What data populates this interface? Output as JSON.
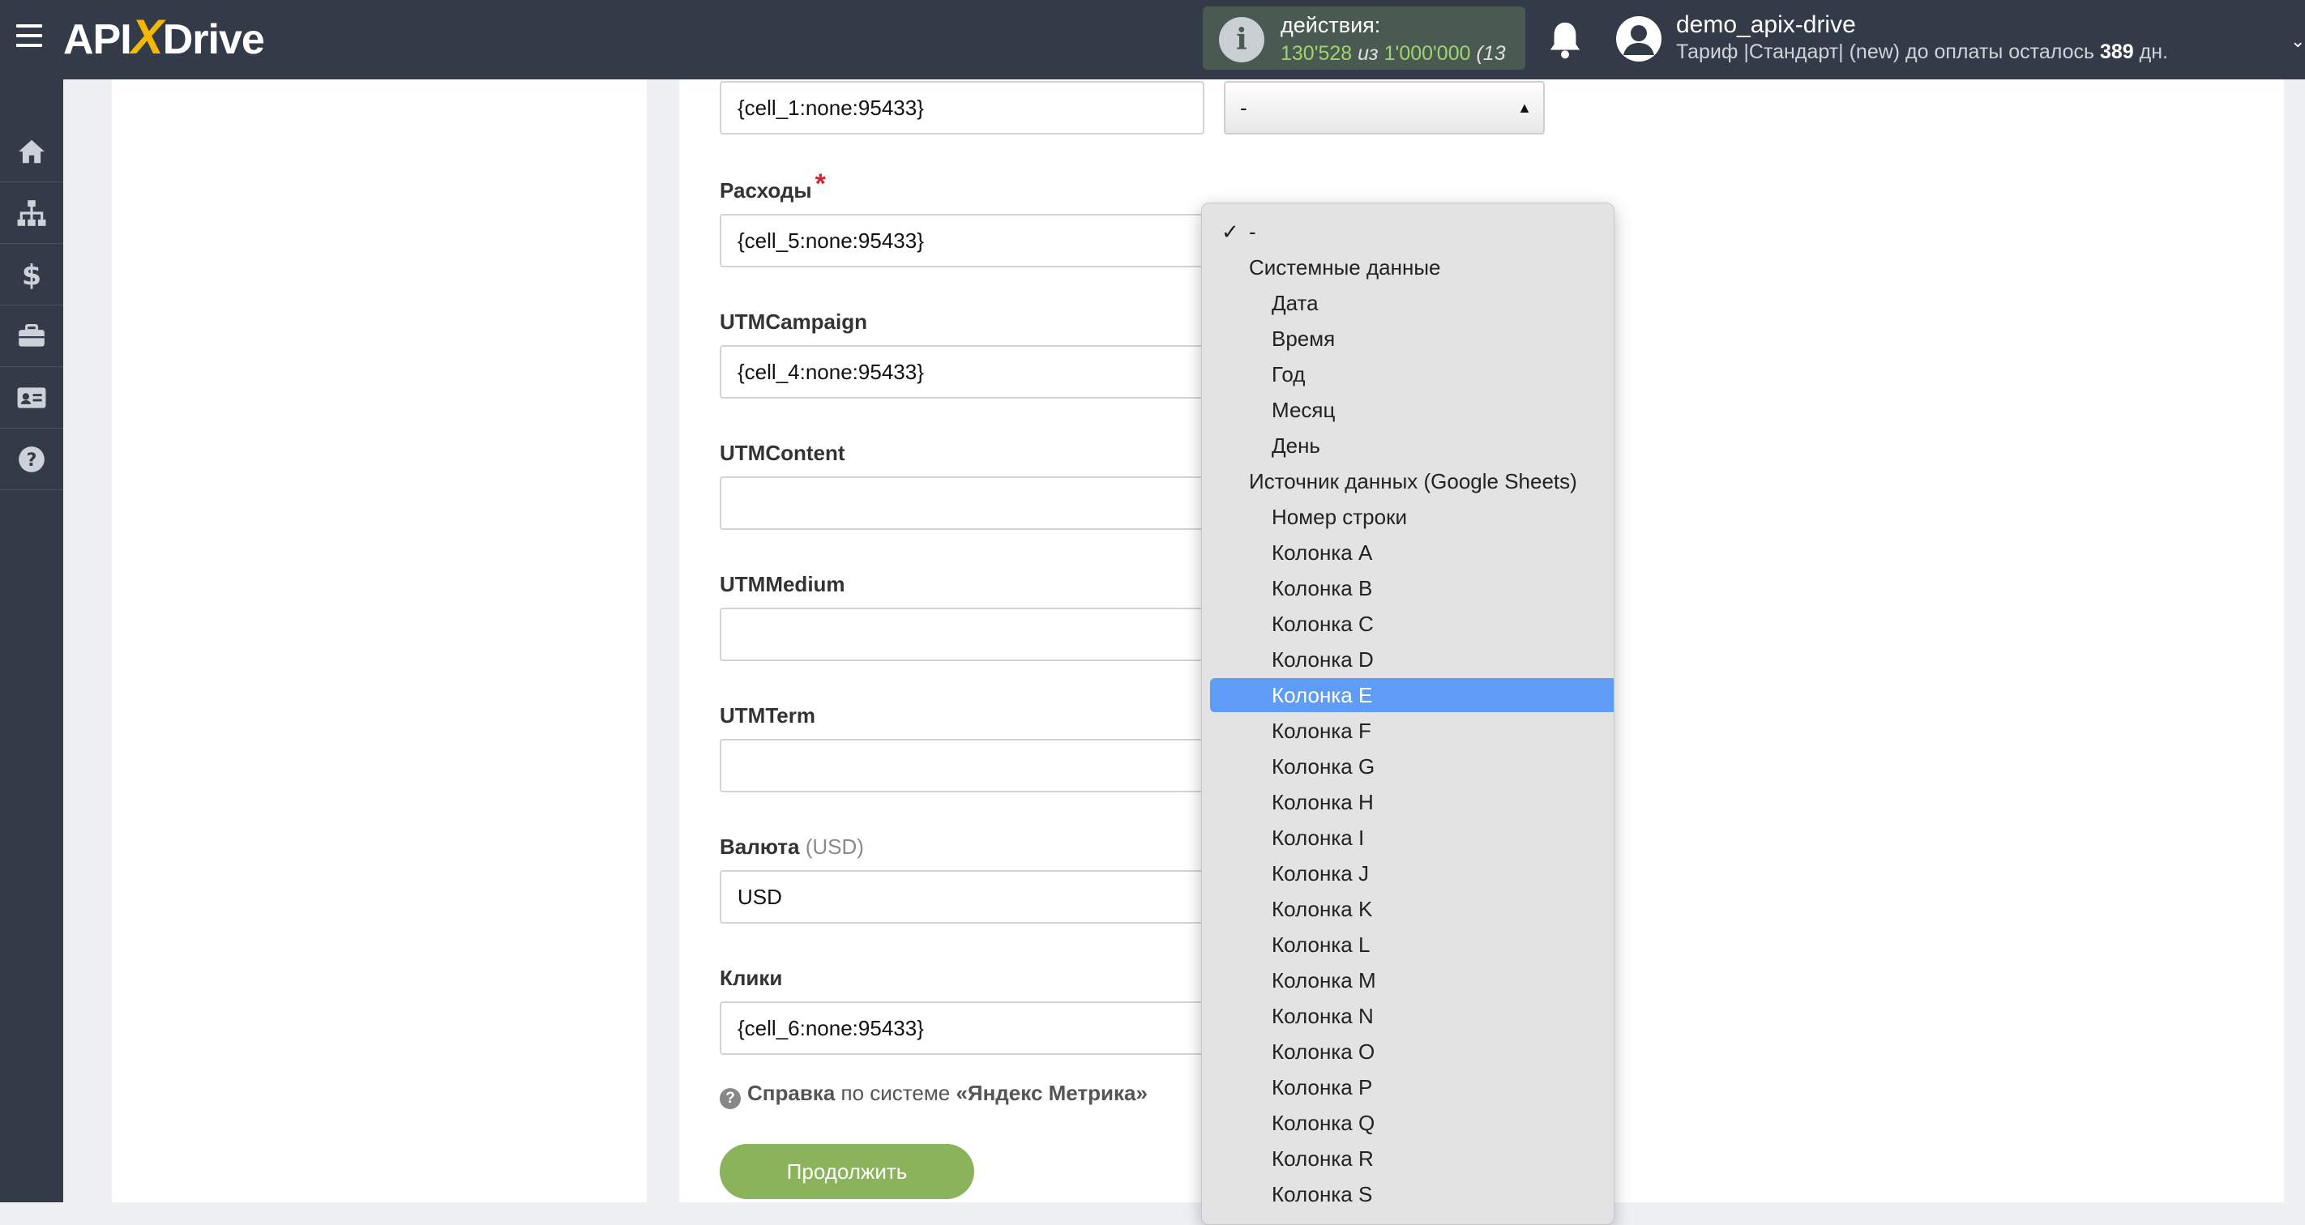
{
  "header": {
    "logo_api": "API",
    "logo_x": "X",
    "logo_drive": "Drive",
    "actions_label": "действия:",
    "actions_used": "130'528",
    "actions_of": "из",
    "actions_total": "1'000'000",
    "actions_extra": "(13",
    "username": "demo_apix-drive",
    "tariff_text": "Тариф |Стандарт| (new) до оплаты осталось",
    "tariff_days": "389",
    "tariff_unit": "дн."
  },
  "sidebar": {
    "items": [
      "home-icon",
      "sitemap-icon",
      "dollar-icon",
      "briefcase-icon",
      "id-card-icon",
      "help-icon"
    ]
  },
  "form": {
    "top_field_value": "{cell_1:none:95433}",
    "top_select_value": "-",
    "fields": [
      {
        "label": "Расходы",
        "required": true,
        "value": "{cell_5:none:95433}"
      },
      {
        "label": "UTMCampaign",
        "value": "{cell_4:none:95433}"
      },
      {
        "label": "UTMContent",
        "value": ""
      },
      {
        "label": "UTMMedium",
        "value": ""
      },
      {
        "label": "UTMTerm",
        "value": ""
      },
      {
        "label": "Валюта",
        "hint": "(USD)",
        "value": "USD"
      },
      {
        "label": "Клики",
        "value": "{cell_6:none:95433}"
      }
    ],
    "required_mark": "*",
    "help_bold": "Справка",
    "help_text": "по системе",
    "help_system": "«Яндекс Метрика»",
    "continue_label": "Продолжить"
  },
  "dropdown": {
    "checkmark": "✓",
    "options": [
      {
        "label": "-",
        "kind": "top",
        "checked": true
      },
      {
        "label": "Системные данные",
        "kind": "group"
      },
      {
        "label": "Дата",
        "kind": "sub"
      },
      {
        "label": "Время",
        "kind": "sub"
      },
      {
        "label": "Год",
        "kind": "sub"
      },
      {
        "label": "Месяц",
        "kind": "sub"
      },
      {
        "label": "День",
        "kind": "sub"
      },
      {
        "label": "Источник данных (Google Sheets)",
        "kind": "group"
      },
      {
        "label": "Номер строки",
        "kind": "sub"
      },
      {
        "label": "Колонка A",
        "kind": "sub"
      },
      {
        "label": "Колонка B",
        "kind": "sub"
      },
      {
        "label": "Колонка C",
        "kind": "sub"
      },
      {
        "label": "Колонка D",
        "kind": "sub"
      },
      {
        "label": "Колонка E",
        "kind": "sub",
        "selected": true
      },
      {
        "label": "Колонка F",
        "kind": "sub"
      },
      {
        "label": "Колонка G",
        "kind": "sub"
      },
      {
        "label": "Колонка H",
        "kind": "sub"
      },
      {
        "label": "Колонка I",
        "kind": "sub"
      },
      {
        "label": "Колонка J",
        "kind": "sub"
      },
      {
        "label": "Колонка K",
        "kind": "sub"
      },
      {
        "label": "Колонка L",
        "kind": "sub"
      },
      {
        "label": "Колонка M",
        "kind": "sub"
      },
      {
        "label": "Колонка N",
        "kind": "sub"
      },
      {
        "label": "Колонка O",
        "kind": "sub"
      },
      {
        "label": "Колонка P",
        "kind": "sub"
      },
      {
        "label": "Колонка Q",
        "kind": "sub"
      },
      {
        "label": "Колонка R",
        "kind": "sub"
      },
      {
        "label": "Колонка S",
        "kind": "sub"
      }
    ]
  },
  "colors": {
    "topbar": "#343b48",
    "accent_green": "#8ab35c",
    "selection_blue": "#5f9cf5",
    "required_red": "#d9232a"
  }
}
